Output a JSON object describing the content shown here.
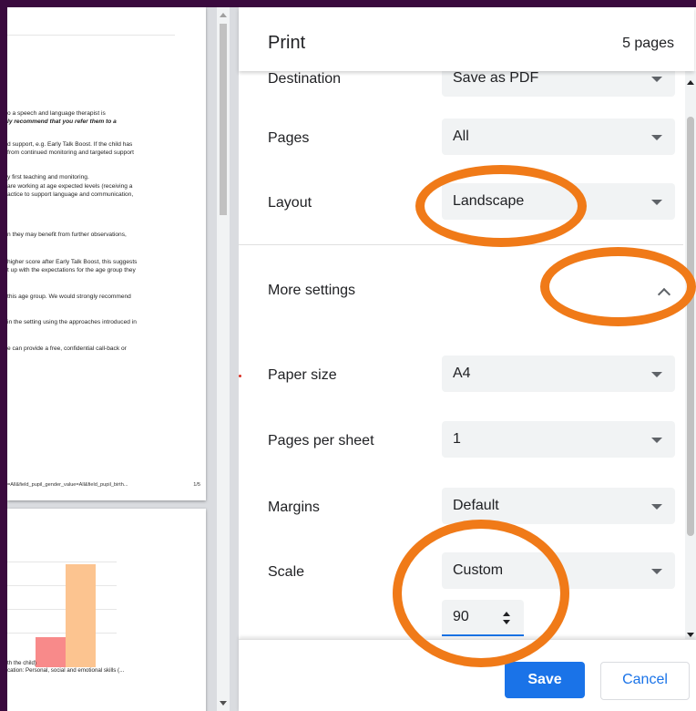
{
  "preview": {
    "page1_lines": [
      "o a speech and language therapist is",
      "ly recommend that you refer them to a",
      "d support, e.g. Early Talk Boost. If the child has",
      " from continued monitoring and targeted support",
      "y first teaching and monitoring.",
      " are working at age expected levels (receiving a",
      "actice to support language and communication,",
      "n they may benefit from further observations,",
      "higher score after Early Talk Boost, this suggests",
      "t up with the expectations for the age group they",
      "this age group. We would strongly recommend",
      "in the setting using the approaches introduced in",
      "e can provide a free, confidential call-back or"
    ],
    "page1_footer": "=All&field_pupil_gender_value=All&field_pupil_birth...",
    "page1_number": "1/5",
    "page2_caption_1": "th the child)",
    "page2_caption_2": "cation: Personal, social and emotional skills (..."
  },
  "header": {
    "title": "Print",
    "page_count": "5 pages"
  },
  "settings": {
    "destination": {
      "label": "Destination",
      "value": "Save as PDF"
    },
    "pages": {
      "label": "Pages",
      "value": "All"
    },
    "layout": {
      "label": "Layout",
      "value": "Landscape"
    },
    "more_settings": {
      "label": "More settings"
    },
    "paper_size": {
      "label": "Paper size",
      "value": "A4"
    },
    "pages_per_sheet": {
      "label": "Pages per sheet",
      "value": "1"
    },
    "margins": {
      "label": "Margins",
      "value": "Default"
    },
    "scale": {
      "label": "Scale",
      "value": "Custom",
      "custom_value": "90"
    }
  },
  "buttons": {
    "save": "Save",
    "cancel": "Cancel"
  },
  "colors": {
    "accent": "#1a73e8",
    "annotation": "#f07a18",
    "frame": "#3a0a3e"
  }
}
